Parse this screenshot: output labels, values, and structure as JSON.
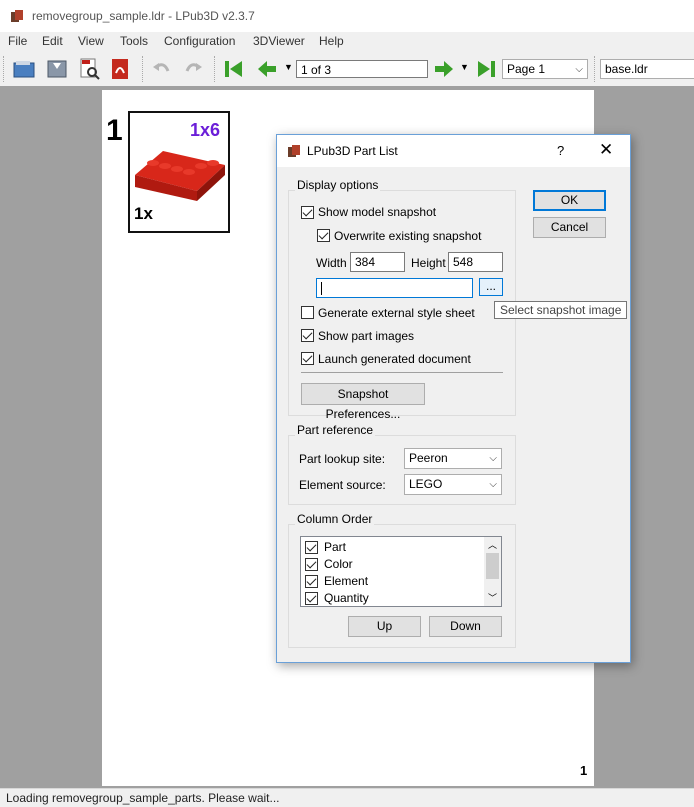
{
  "window": {
    "title": "removegroup_sample.ldr - LPub3D v2.3.7"
  },
  "menu": [
    "File",
    "Edit",
    "View",
    "Tools",
    "Configuration",
    "3DViewer",
    "Help"
  ],
  "toolbar": {
    "page_field": "1 of 3",
    "page_combo": "Page 1",
    "model_combo": "base.ldr"
  },
  "page": {
    "step_number": "1",
    "part_size": "1x6",
    "part_qty": "1x",
    "page_number": "1",
    "part_color": "#cc1a10"
  },
  "status": {
    "text": "Loading removegroup_sample_parts. Please wait..."
  },
  "dialog": {
    "title": "LPub3D Part List",
    "help": "?",
    "ok_label": "OK",
    "cancel_label": "Cancel",
    "display_options": {
      "label": "Display options",
      "show_model_snapshot": {
        "label": "Show model snapshot",
        "checked": true
      },
      "overwrite_snapshot": {
        "label": "Overwrite existing snapshot",
        "checked": true
      },
      "width_label": "Width",
      "width_value": "384",
      "height_label": "Height",
      "height_value": "548",
      "snapshot_path": "",
      "browse_label": "...",
      "generate_style_sheet": {
        "label": "Generate external style sheet",
        "checked": false
      },
      "show_part_images": {
        "label": "Show part images",
        "checked": true
      },
      "launch_document": {
        "label": "Launch generated document",
        "checked": true
      },
      "snapshot_prefs_label": "Snapshot Preferences..."
    },
    "part_reference": {
      "label": "Part reference",
      "lookup_label": "Part lookup site:",
      "lookup_value": "Peeron",
      "element_label": "Element source:",
      "element_value": "LEGO"
    },
    "column_order": {
      "label": "Column Order",
      "items": [
        {
          "label": "Part",
          "checked": true
        },
        {
          "label": "Color",
          "checked": true
        },
        {
          "label": "Element",
          "checked": true
        },
        {
          "label": "Quantity",
          "checked": true
        }
      ],
      "up_label": "Up",
      "down_label": "Down"
    },
    "tooltip": "Select snapshot image"
  }
}
